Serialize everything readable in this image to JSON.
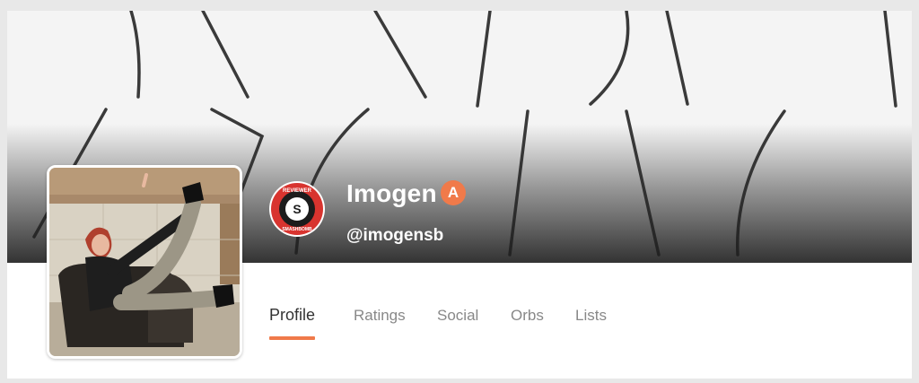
{
  "profile": {
    "name": "Imogen",
    "verified_icon": "A",
    "handle": "@imogensb",
    "badge": {
      "top_text": "REVIEWER",
      "bottom_text": "SMASHBOMB",
      "center_glyph": "S"
    }
  },
  "tabs": [
    {
      "label": "Profile",
      "active": true
    },
    {
      "label": "Ratings",
      "active": false
    },
    {
      "label": "Social",
      "active": false
    },
    {
      "label": "Orbs",
      "active": false
    },
    {
      "label": "Lists",
      "active": false
    }
  ],
  "colors": {
    "accent": "#f07a4a",
    "badge_red": "#d8342f",
    "text_dark": "#333333",
    "text_muted": "#888888"
  }
}
